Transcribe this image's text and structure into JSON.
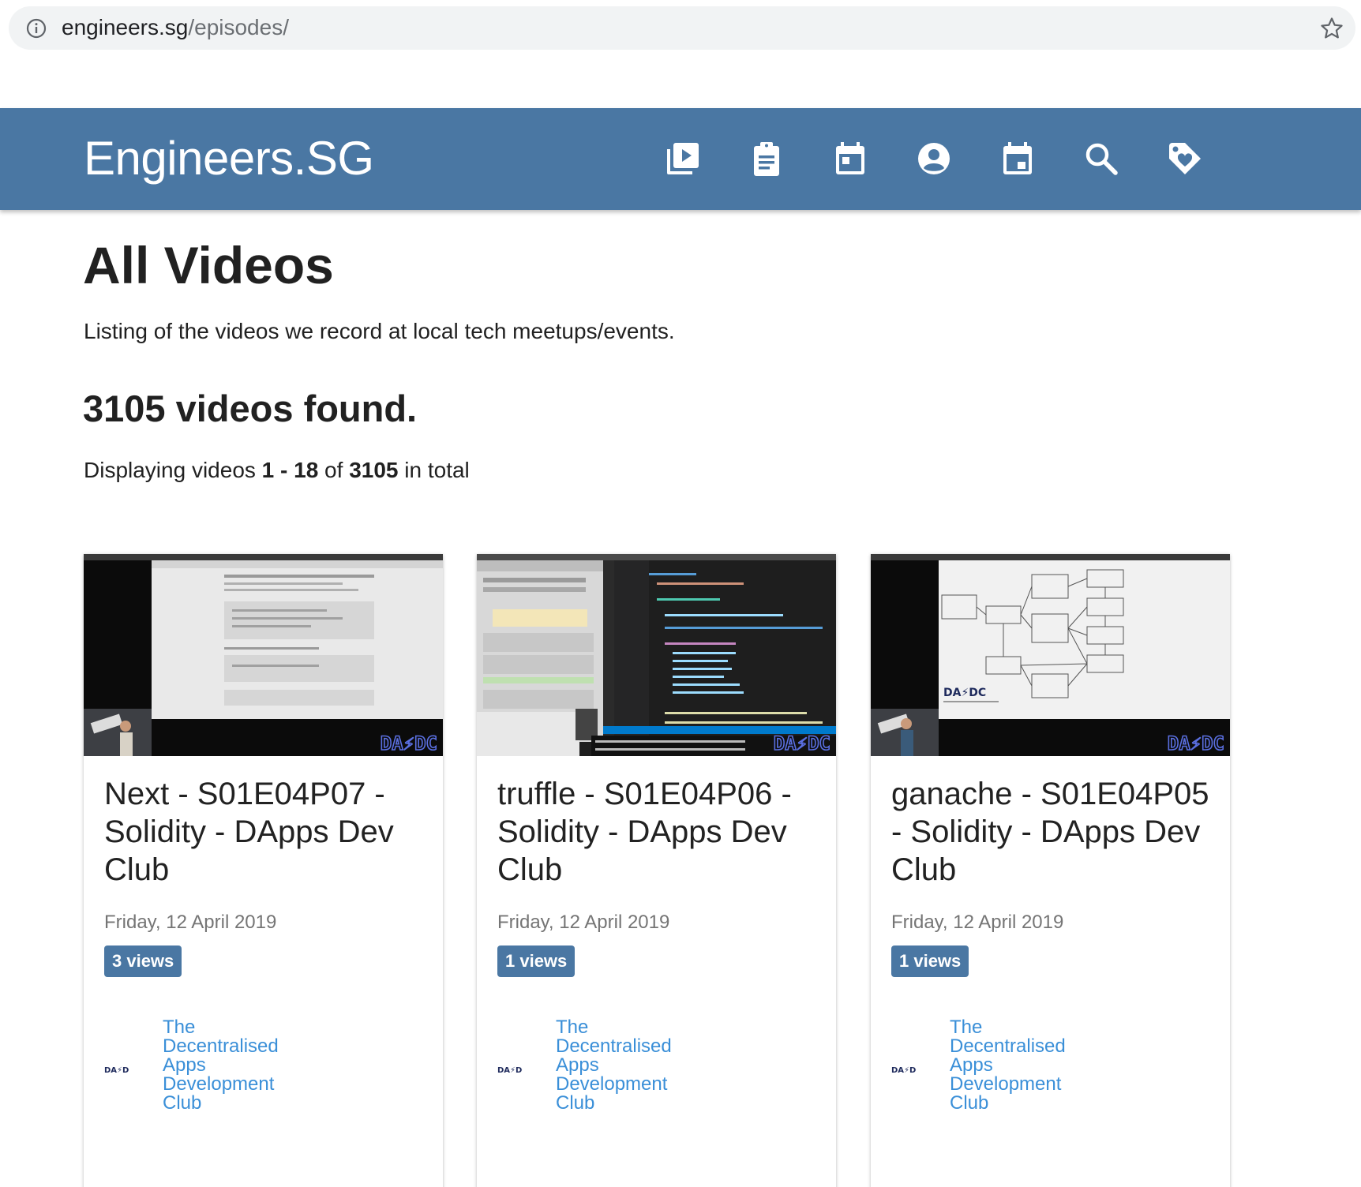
{
  "browser": {
    "url_host": "engineers.sg",
    "url_path": "/episodes/"
  },
  "navbar": {
    "brand": "Engineers.SG",
    "icons": [
      "video-library-icon",
      "clipboard-icon",
      "calendar-icon",
      "account-circle-icon",
      "event-icon",
      "search-icon",
      "tag-icon"
    ]
  },
  "page": {
    "title": "All Videos",
    "intro": "Listing of the videos we record at local tech meetups/events.",
    "found": "3105 videos found.",
    "displaying": {
      "prefix": "Displaying videos ",
      "range": "1 - 18",
      "of": " of ",
      "total": "3105",
      "suffix": " in total"
    }
  },
  "videos": [
    {
      "title": "Next - S01E04P07 - Solidity - DApps Dev Club",
      "date": "Friday, 12 April 2019",
      "views": "3 views",
      "org_logo": "DA⚡DC",
      "org": "The Decentralised Apps Development Club",
      "thumb_watermark": "DA⚡DC"
    },
    {
      "title": "truffle - S01E04P06 - Solidity - DApps Dev Club",
      "date": "Friday, 12 April 2019",
      "views": "1 views",
      "org_logo": "DA⚡DC",
      "org": "The Decentralised Apps Development Club",
      "thumb_watermark": "DA⚡DC"
    },
    {
      "title": "ganache - S01E04P05 - Solidity - DApps Dev Club",
      "date": "Friday, 12 April 2019",
      "views": "1 views",
      "org_logo": "DA⚡DC",
      "org": "The Decentralised Apps Development Club",
      "thumb_watermark": "DA⚡DC"
    }
  ],
  "colors": {
    "navbar": "#4a77a3",
    "badge": "#4a77a3",
    "link": "#3a8fd8",
    "muted": "#757575"
  }
}
